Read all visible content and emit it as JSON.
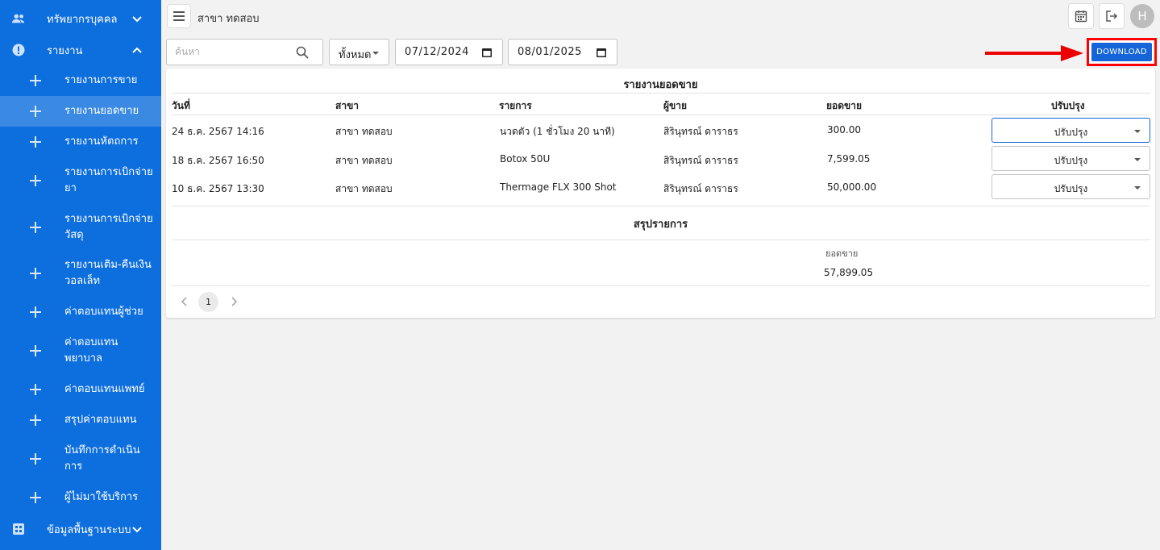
{
  "sidebar": {
    "group_hr": "ทรัพยากรบุคคล",
    "group_report": "รายงาน",
    "items": [
      {
        "label": "รายงานการขาย"
      },
      {
        "label": "รายงานยอดขาย"
      },
      {
        "label": "รายงานหัตถการ"
      },
      {
        "label": "รายงานการเบิกจ่ายยา"
      },
      {
        "label": "รายงานการเบิกจ่ายวัสดุ"
      },
      {
        "label": "รายงานเติม-คืนเงินวอลเล็ท"
      },
      {
        "label": "ค่าตอบแทนผู้ช่วย"
      },
      {
        "label": "ค่าตอบแทนพยาบาล"
      },
      {
        "label": "ค่าตอบแทนแพทย์"
      },
      {
        "label": "สรุปค่าตอบแทน"
      },
      {
        "label": "บันทึกการดำเนินการ"
      },
      {
        "label": "ผู้ไม่มาใช้บริการ"
      }
    ],
    "group_master": "ข้อมูลพื้นฐานระบบ"
  },
  "topbar": {
    "branch": "สาขา ทดสอบ",
    "avatar_letter": "H"
  },
  "filters": {
    "search_placeholder": "ค้นหา",
    "scope": "ทั้งหมด",
    "date_from": "07/12/2024",
    "date_to": "08/01/2025",
    "download": "DOWNLOAD"
  },
  "report": {
    "title": "รายงานยอดขาย",
    "columns": [
      "วันที่",
      "สาขา",
      "รายการ",
      "ผู้ขาย",
      "ยอดขาย",
      "ปรับปรุง"
    ],
    "rows": [
      {
        "date": "24 ธ.ค. 2567 14:16",
        "branch": "สาขา ทดสอบ",
        "item": "นวดตัว (1 ชั่วโมง 20 นาที)",
        "seller": "สิรินุทรณ์ ดาราธร",
        "amount": "300.00",
        "adjust": "ปรับปรุง"
      },
      {
        "date": "18 ธ.ค. 2567 16:50",
        "branch": "สาขา ทดสอบ",
        "item": "Botox 50U",
        "seller": "สิรินุทรณ์ ดาราธร",
        "amount": "7,599.05",
        "adjust": "ปรับปรุง"
      },
      {
        "date": "10 ธ.ค. 2567 13:30",
        "branch": "สาขา ทดสอบ",
        "item": "Thermage FLX 300 Shot",
        "seller": "สิรินุทรณ์ ดาราธร",
        "amount": "50,000.00",
        "adjust": "ปรับปรุง"
      }
    ],
    "summary_title": "สรุปรายการ",
    "summary_label": "ยอดขาย",
    "summary_value": "57,899.05"
  },
  "pagination": {
    "current_page": "1"
  },
  "colors": {
    "sidebar": "#0d6ede",
    "accent": "#1565d8",
    "highlight": "#ff0000"
  },
  "icons": [
    "people-icon",
    "alert-icon",
    "grid-icon",
    "menu-icon",
    "calendar-icon",
    "logout-icon",
    "search-icon",
    "arrow-icon"
  ]
}
